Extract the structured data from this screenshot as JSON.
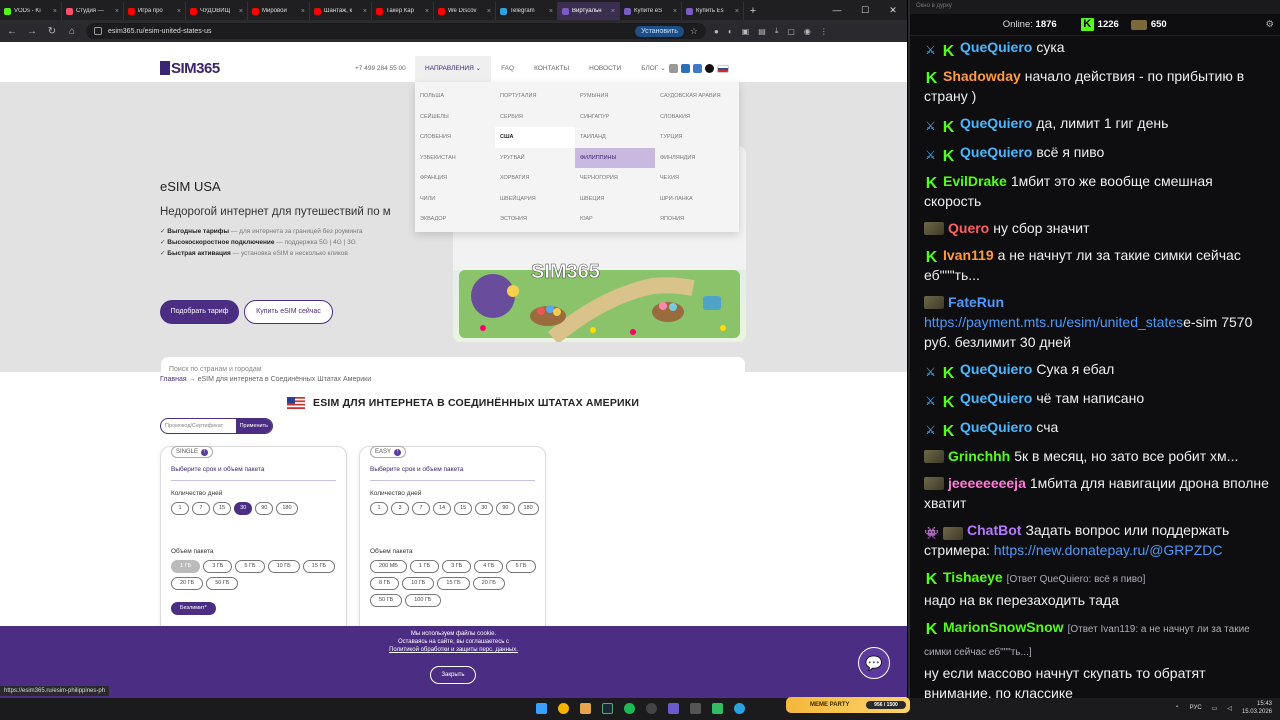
{
  "browser": {
    "tabs": [
      {
        "title": "VODs - Ki",
        "color": "#53fc18",
        "active": false
      },
      {
        "title": "Студия —",
        "color": "#ff4e6a",
        "active": false
      },
      {
        "title": "Игра про",
        "color": "#ff0000",
        "active": false
      },
      {
        "title": "ЧУДОВИЩ",
        "color": "#ff0000",
        "active": false
      },
      {
        "title": "Мировой",
        "color": "#ff0000",
        "active": false
      },
      {
        "title": "Шантаж, к",
        "color": "#ff0000",
        "active": false
      },
      {
        "title": "Такер Кар",
        "color": "#ff0000",
        "active": false
      },
      {
        "title": "We Discov",
        "color": "#ff0000",
        "active": false
      },
      {
        "title": "Telegram",
        "color": "#2aa3e0",
        "active": false
      },
      {
        "title": "Виртуальн",
        "color": "#7a5cc4",
        "active": true
      },
      {
        "title": "Купите eS",
        "color": "#7a5cc4",
        "active": false
      },
      {
        "title": "Купить Es",
        "color": "#7a5cc4",
        "active": false
      }
    ],
    "url": "esim365.ru/esim-united-states-us",
    "install_label": "Установить",
    "status_url": "https://esim365.ru/esim-philippines-ph"
  },
  "site": {
    "logo": "SIM365",
    "phone": "+7 499 284 55 00",
    "nav": [
      "Направления",
      "FAQ",
      "Контакты",
      "Новости",
      "Блог"
    ],
    "hero_title": "eSIM USA",
    "hero_subtitle": "Недорогой интернет для путешествий по м",
    "bullets": [
      {
        "bold": "Выгодные тарифы",
        "rest": " — для интернета за границей без роуминга"
      },
      {
        "bold": "Высокоскоростное подключение",
        "rest": " — поддержка 5G | 4G | 3G"
      },
      {
        "bold": "Быстрая активация",
        "rest": " — установка eSIM в несколько кликов"
      }
    ],
    "btn_pick": "Подобрать тариф",
    "btn_buy": "Купить eSIM сейчас",
    "search_placeholder": "Поиск по странам и городам",
    "dropdown": [
      "Польша",
      "Португалия",
      "Румыния",
      "Саудовская Аравия",
      "Сейшелы",
      "Сербия",
      "Сингапур",
      "Словакия",
      "Словения",
      "США",
      "Таиланд",
      "Турция",
      "Узбекистан",
      "Уругвай",
      "Филиппины",
      "Финляндия",
      "Франция",
      "Хорватия",
      "Черногория",
      "Чехия",
      "Чили",
      "Швейцария",
      "Швеция",
      "Шри-Ланка",
      "Эквадор",
      "Эстония",
      "ЮАР",
      "Япония"
    ],
    "dropdown_selected": "США",
    "dropdown_hover": "Филиппины",
    "breadcrumb_home": "Главная",
    "breadcrumb_current": "eSIM для интернета в Соединённых Штатах Америки",
    "section_title": "ESIM ДЛЯ ИНТЕРНЕТА В СОЕДИНЁННЫХ ШТАТАХ АМЕРИКИ",
    "promo_placeholder": "Промокод/Сертификат",
    "promo_apply": "Применить",
    "cards": [
      {
        "tag": "SINGLE",
        "heading": "Выберите срок и объем пакета",
        "days_label": "Количество дней",
        "days": [
          "1",
          "7",
          "15",
          "30",
          "90",
          "180"
        ],
        "days_selected": "30",
        "volume_label": "Объем пакета",
        "volumes": [
          "1 ГБ",
          "3 ГБ",
          "5 ГБ",
          "10 ГБ",
          "15 ГБ",
          "20 ГБ",
          "50 ГБ"
        ],
        "volume_disabled": "1 ГБ",
        "unlimited": "Безлимит*"
      },
      {
        "tag": "EASY",
        "heading": "Выберите срок и объем пакета",
        "days_label": "Количество дней",
        "days": [
          "1",
          "3",
          "7",
          "14",
          "15",
          "30",
          "90",
          "180"
        ],
        "volume_label": "Объем пакета",
        "volumes": [
          "200 МБ",
          "1 ГБ",
          "3 ГБ",
          "4 ГБ",
          "5 ГБ",
          "8 ГБ",
          "10 ГБ",
          "15 ГБ",
          "20 ГБ",
          "50 ГБ",
          "100 ГБ"
        ]
      }
    ],
    "cookie": {
      "line1": "Мы используем файлы cookie.",
      "line2": "Оставаясь на сайте, вы соглашаетесь с",
      "line3": "Политикой обработки и защиты перс. данных.",
      "close": "Закрыть"
    }
  },
  "chat": {
    "window_title": "Окно в дурку",
    "online_label": "Online:",
    "online_count": "1876",
    "stat1": "1226",
    "stat2": "650",
    "messages": [
      {
        "user": "QueQuiero",
        "color": "#4ab8ff",
        "badges": [
          "sword",
          "k"
        ],
        "text": "сука"
      },
      {
        "user": "Shadowday",
        "color": "#ff9b3d",
        "badges": [
          "k"
        ],
        "text": "начало действия - по прибытию в страну )"
      },
      {
        "user": "QueQuiero",
        "color": "#4ab8ff",
        "badges": [
          "sword",
          "k"
        ],
        "text": "да, лимит 1 гиг день"
      },
      {
        "user": "QueQuiero",
        "color": "#4ab8ff",
        "badges": [
          "sword",
          "k"
        ],
        "text": "всё я пиво"
      },
      {
        "user": "EvilDrake",
        "color": "#53fc18",
        "badges": [
          "k"
        ],
        "text": "1мбит это же вообще смешная скорость"
      },
      {
        "user": "Quero",
        "color": "#ff5f5f",
        "badges": [
          "gun"
        ],
        "text": "ну сбор значит"
      },
      {
        "user": "Ivan119",
        "color": "#ff9b3d",
        "badges": [
          "k"
        ],
        "text": "а не начнут ли за такие симки сейчас еб\"\"\"ть..."
      },
      {
        "user": "FateRun",
        "color": "#4a9bff",
        "badges": [
          "gun"
        ],
        "link": "https://payment.mts.ru/esim/united_states",
        "text": "e-sim 7570 руб. безлимит 30 дней"
      },
      {
        "user": "QueQuiero",
        "color": "#4ab8ff",
        "badges": [
          "sword",
          "k"
        ],
        "text": "Сука я ебал"
      },
      {
        "user": "QueQuiero",
        "color": "#4ab8ff",
        "badges": [
          "sword",
          "k"
        ],
        "text": "чё там написано"
      },
      {
        "user": "QueQuiero",
        "color": "#4ab8ff",
        "badges": [
          "sword",
          "k"
        ],
        "text": "сча"
      },
      {
        "user": "Grinchhh",
        "color": "#53fc18",
        "badges": [
          "gun"
        ],
        "text": "5к в месяц, но зато все робит хм..."
      },
      {
        "user": "jeeeeeeeeja",
        "color": "#ff7ad9",
        "badges": [
          "gun"
        ],
        "text": "1мбита для навигации дрона вполне хватит"
      },
      {
        "user": "ChatBot",
        "color": "#b678ff",
        "badges": [
          "alien",
          "gun"
        ],
        "text": "Задать вопрос или поддержать стримера:",
        "link_after": "https://new.donatepay.ru/@GRPZDC"
      },
      {
        "user": "Tishaeye",
        "color": "#53fc18",
        "badges": [
          "k"
        ],
        "reply": "[Ответ QueQuiero: всё я пиво]",
        "text": "надо на вк перезаходить тада"
      },
      {
        "user": "MarionSnowSnow",
        "color": "#53fc18",
        "badges": [
          "k"
        ],
        "reply": "[Ответ Ivan119: а не начнут ли за такие симки сейчас еб\"\"\"ть...]",
        "text": "ну если массово начнут скупать то обратят внимание, по классике"
      }
    ]
  },
  "taskbar": {
    "meme_label": "MEME PARTY",
    "meme_progress": "956 / 1500",
    "lang": "РУС",
    "time": "15:43",
    "date": "15.03.2026"
  }
}
